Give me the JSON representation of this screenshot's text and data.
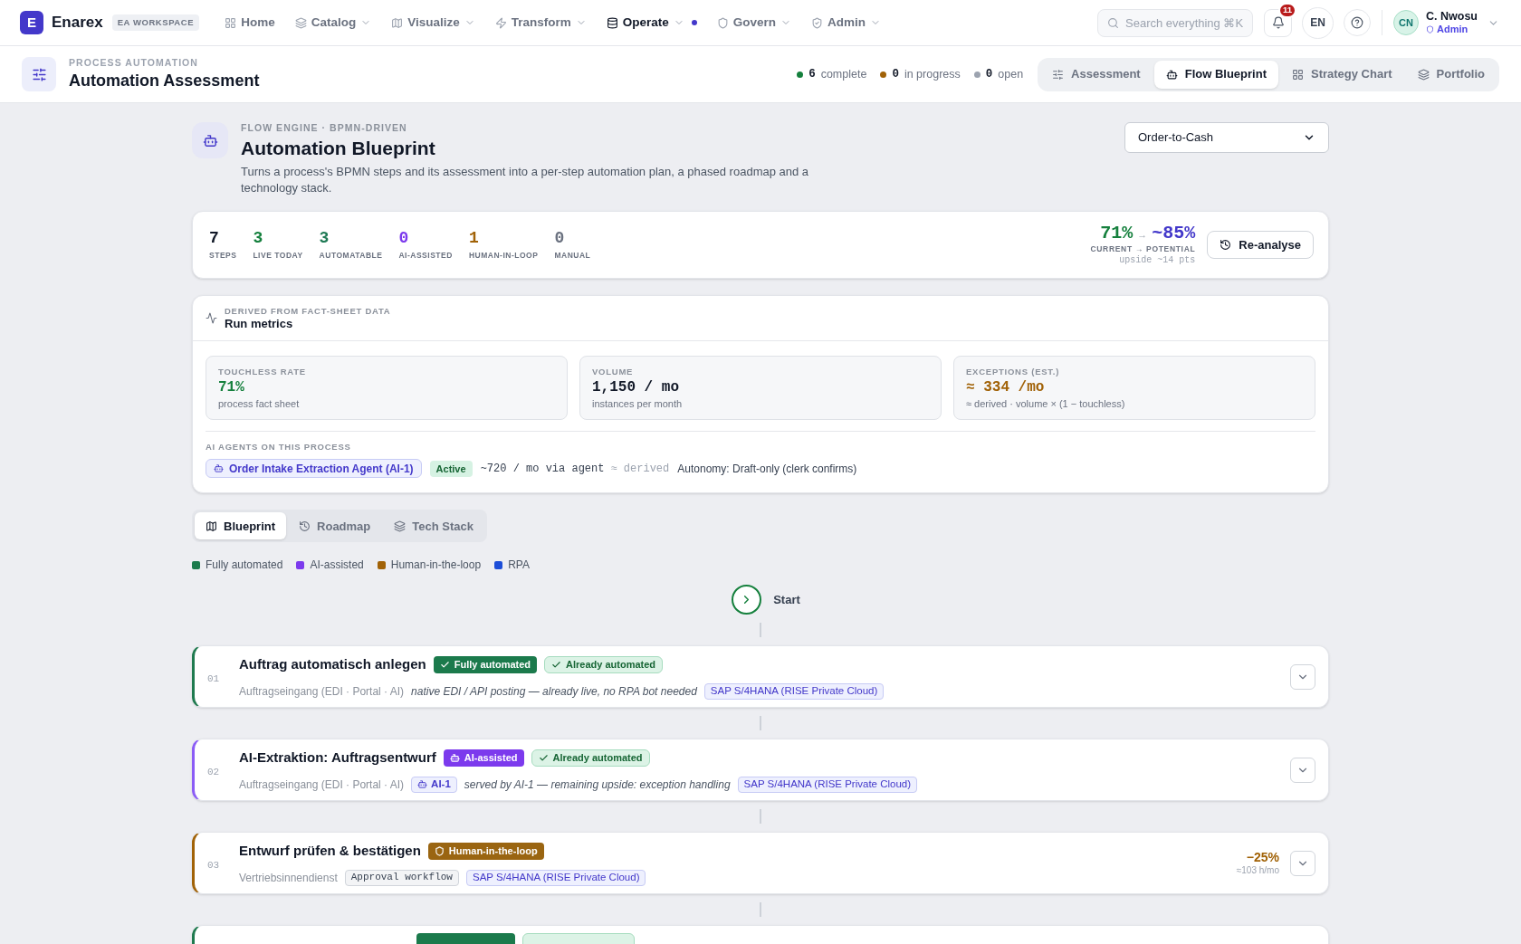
{
  "top_nav": {
    "logo": "E",
    "brand": "Enarex",
    "workspace": "EA WORKSPACE",
    "items": [
      {
        "label": "Home",
        "selected": false,
        "dropdown": false
      },
      {
        "label": "Catalog",
        "selected": false,
        "dropdown": true
      },
      {
        "label": "Visualize",
        "selected": false,
        "dropdown": true
      },
      {
        "label": "Transform",
        "selected": false,
        "dropdown": true
      },
      {
        "label": "Operate",
        "selected": true,
        "dropdown": true
      },
      {
        "label": "Govern",
        "selected": false,
        "dropdown": true
      },
      {
        "label": "Admin",
        "selected": false,
        "dropdown": true
      }
    ],
    "search": {
      "placeholder": "Search everything ⌘K"
    },
    "notifications": "11",
    "language": "EN",
    "user": {
      "initials": "CN",
      "name": "C. Nwosu",
      "role": "Admin"
    }
  },
  "page_header": {
    "eyebrow": "PROCESS AUTOMATION",
    "title": "Automation Assessment",
    "status": [
      {
        "count": "6",
        "label": "complete",
        "color": "#15803d"
      },
      {
        "count": "0",
        "label": "in progress",
        "color": "#a16207"
      },
      {
        "count": "0",
        "label": "open",
        "color": "#9ca3af"
      }
    ],
    "tabs": [
      {
        "label": "Assessment",
        "selected": false
      },
      {
        "label": "Flow Blueprint",
        "selected": true
      },
      {
        "label": "Strategy Chart",
        "selected": false
      },
      {
        "label": "Portfolio",
        "selected": false
      }
    ]
  },
  "blueprint": {
    "eyebrow": "FLOW ENGINE · BPMN-DRIVEN",
    "title": "Automation Blueprint",
    "description": "Turns a process's BPMN steps and its assessment into a per-step automation plan, a phased roadmap and a technology stack.",
    "process_select": {
      "value": "Order-to-Cash"
    }
  },
  "summary": {
    "stats": [
      {
        "value": "7",
        "label": "STEPS",
        "color": "#111827"
      },
      {
        "value": "3",
        "label": "LIVE TODAY",
        "color": "#15803d"
      },
      {
        "value": "3",
        "label": "AUTOMATABLE",
        "color": "#1f7a55"
      },
      {
        "value": "0",
        "label": "AI-ASSISTED",
        "color": "#7c3aed"
      },
      {
        "value": "1",
        "label": "HUMAN-IN-LOOP",
        "color": "#a16207"
      },
      {
        "value": "0",
        "label": "MANUAL",
        "color": "#6b7280"
      }
    ],
    "current": "71%",
    "arrow": "→",
    "potential": "~85%",
    "caption": "CURRENT → POTENTIAL",
    "upside": "upside ~14 pts",
    "reanalyse": "Re-analyse"
  },
  "run_metrics": {
    "eyebrow": "DERIVED FROM FACT-SHEET DATA",
    "title": "Run metrics",
    "metrics": [
      {
        "label": "TOUCHLESS RATE",
        "value": "71%",
        "note": "process fact sheet",
        "color": "#15803d"
      },
      {
        "label": "VOLUME",
        "value": "1,150 / mo",
        "note": "instances per month",
        "color": "#111827"
      },
      {
        "label": "EXCEPTIONS (EST.)",
        "value": "≈ 334 /mo",
        "note": "≈ derived · volume × (1 − touchless)",
        "color": "#a16207"
      }
    ],
    "agents_heading": "AI AGENTS ON THIS PROCESS",
    "agents": [
      {
        "name": "Order Intake Extraction Agent (AI-1)",
        "status": "Active",
        "volume": "~720 / mo via agent",
        "derived": "≈ derived",
        "autonomy": "Autonomy: Draft-only (clerk confirms)"
      }
    ]
  },
  "view_tabs": [
    {
      "label": "Blueprint",
      "selected": true
    },
    {
      "label": "Roadmap",
      "selected": false
    },
    {
      "label": "Tech Stack",
      "selected": false
    }
  ],
  "legend": [
    {
      "label": "Fully automated",
      "color": "#1b7a4c"
    },
    {
      "label": "AI-assisted",
      "color": "#7c3aed"
    },
    {
      "label": "Human-in-the-loop",
      "color": "#a16207"
    },
    {
      "label": "RPA",
      "color": "#1d4ed8"
    }
  ],
  "flow": {
    "start": "Start",
    "steps": [
      {
        "number": "01",
        "title": "Auftrag automatisch anlegen",
        "kind": "fully_automated",
        "expanded": false,
        "badges": [
          {
            "kind": "mode",
            "label": "Fully automated"
          },
          {
            "kind": "already",
            "label": "Already automated"
          }
        ],
        "lane": "Auftragseingang (EDI · Portal · AI)",
        "tags": [
          {
            "kind": "note",
            "text": "native EDI / API posting — already live, no RPA bot needed"
          },
          {
            "kind": "system",
            "text": "SAP S/4HANA (RISE Private Cloud)"
          }
        ]
      },
      {
        "number": "02",
        "title": "AI-Extraktion: Auftragsentwurf",
        "kind": "ai_assisted",
        "expanded": false,
        "badges": [
          {
            "kind": "mode",
            "label": "AI-assisted"
          },
          {
            "kind": "already",
            "label": "Already automated"
          }
        ],
        "lane": "Auftragseingang (EDI · Portal · AI)",
        "tags": [
          {
            "kind": "agent",
            "text": "AI-1"
          },
          {
            "kind": "note",
            "text": "served by AI-1 — remaining upside: exception handling"
          },
          {
            "kind": "system",
            "text": "SAP S/4HANA (RISE Private Cloud)"
          }
        ]
      },
      {
        "number": "03",
        "title": "Entwurf prüfen & bestätigen",
        "kind": "human_in_loop",
        "expanded": false,
        "badges": [
          {
            "kind": "mode",
            "label": "Human-in-the-loop"
          }
        ],
        "lane": "Vertriebsinnendienst",
        "tags": [
          {
            "kind": "workflow",
            "text": "Approval workflow"
          },
          {
            "kind": "system",
            "text": "SAP S/4HANA (RISE Private Cloud)"
          }
        ],
        "impact": {
          "value": "−25%",
          "hours": "≈103 h/mo"
        }
      },
      {
        "kind": "fully_automated",
        "badges": [
          {
            "kind": "mode"
          },
          {
            "kind": "already"
          }
        ]
      }
    ]
  }
}
